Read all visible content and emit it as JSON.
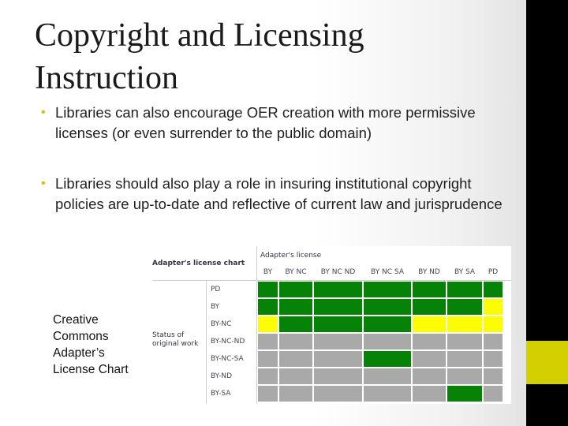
{
  "slide": {
    "title": "Copyright and Licensing Instruction",
    "bullets": [
      "Libraries can also encourage OER creation with more permissive licenses (or even surrender to the public domain)",
      "Libraries should also play a role in insuring institutional copyright policies are up-to-date and reflective of current law and jurisprudence"
    ],
    "caption": "Creative Commons Adapter’s License Chart",
    "colors": {
      "accent": "#d4cf00",
      "bar": "#000000"
    }
  },
  "license_chart": {
    "title": "Adapter's license chart",
    "column_header": "Adapter's license",
    "row_header": "Status of original work",
    "columns": [
      "BY",
      "BY NC",
      "BY NC ND",
      "BY NC SA",
      "BY ND",
      "BY SA",
      "PD"
    ],
    "rows": [
      "PD",
      "BY",
      "BY-NC",
      "BY-NC-ND",
      "BY-NC-SA",
      "BY-ND",
      "BY-SA"
    ],
    "legend_colors": {
      "G": "#068306",
      "Y": "#fcfc04",
      "X": "#a9a9a9"
    },
    "matrix": [
      [
        "G",
        "G",
        "G",
        "G",
        "G",
        "G",
        "G"
      ],
      [
        "G",
        "G",
        "G",
        "G",
        "G",
        "G",
        "Y"
      ],
      [
        "Y",
        "G",
        "G",
        "G",
        "Y",
        "Y",
        "Y"
      ],
      [
        "X",
        "X",
        "X",
        "X",
        "X",
        "X",
        "X"
      ],
      [
        "X",
        "X",
        "X",
        "G",
        "X",
        "X",
        "X"
      ],
      [
        "X",
        "X",
        "X",
        "X",
        "X",
        "X",
        "X"
      ],
      [
        "X",
        "X",
        "X",
        "X",
        "X",
        "G",
        "X"
      ]
    ]
  }
}
